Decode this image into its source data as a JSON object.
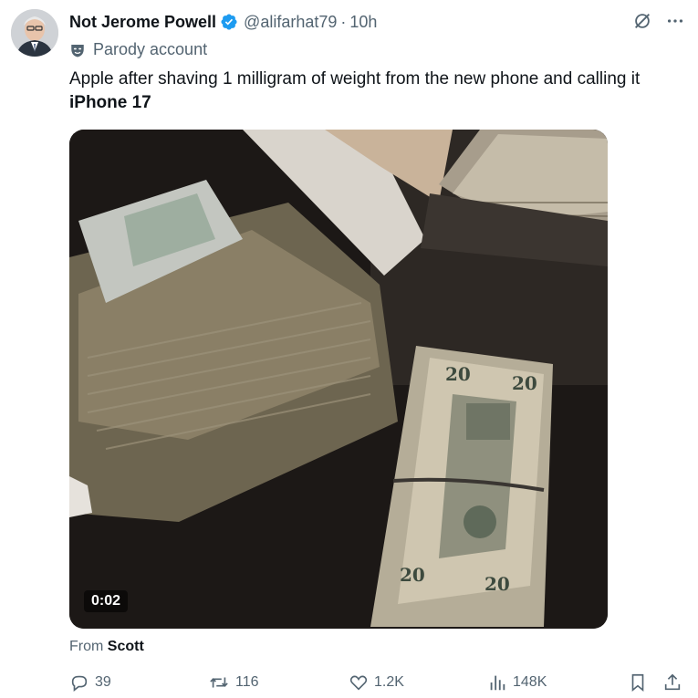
{
  "author": {
    "name": "Not Jerome Powell",
    "handle": "@alifarhat79",
    "separator": "·",
    "time": "10h",
    "badge": "Parody account"
  },
  "tweet": {
    "text_line1": "Apple after shaving 1 milligram of weight from the new phone and calling it",
    "text_bold": "iPhone 17"
  },
  "media": {
    "timer": "0:02"
  },
  "source": {
    "prefix": "From",
    "name": "Scott"
  },
  "actions": {
    "replies": "39",
    "reposts": "116",
    "likes": "1.2K",
    "views": "148K"
  },
  "icons": {
    "verified": "verified-badge-icon",
    "grok": "grok-icon",
    "more": "more-icon",
    "parody": "parody-mask-icon",
    "reply": "reply-icon",
    "repost": "repost-icon",
    "like": "heart-icon",
    "views": "views-icon",
    "bookmark": "bookmark-icon",
    "share": "share-icon"
  },
  "colors": {
    "verified": "#1d9bf0",
    "secondary": "#536471",
    "text": "#0f1419"
  }
}
